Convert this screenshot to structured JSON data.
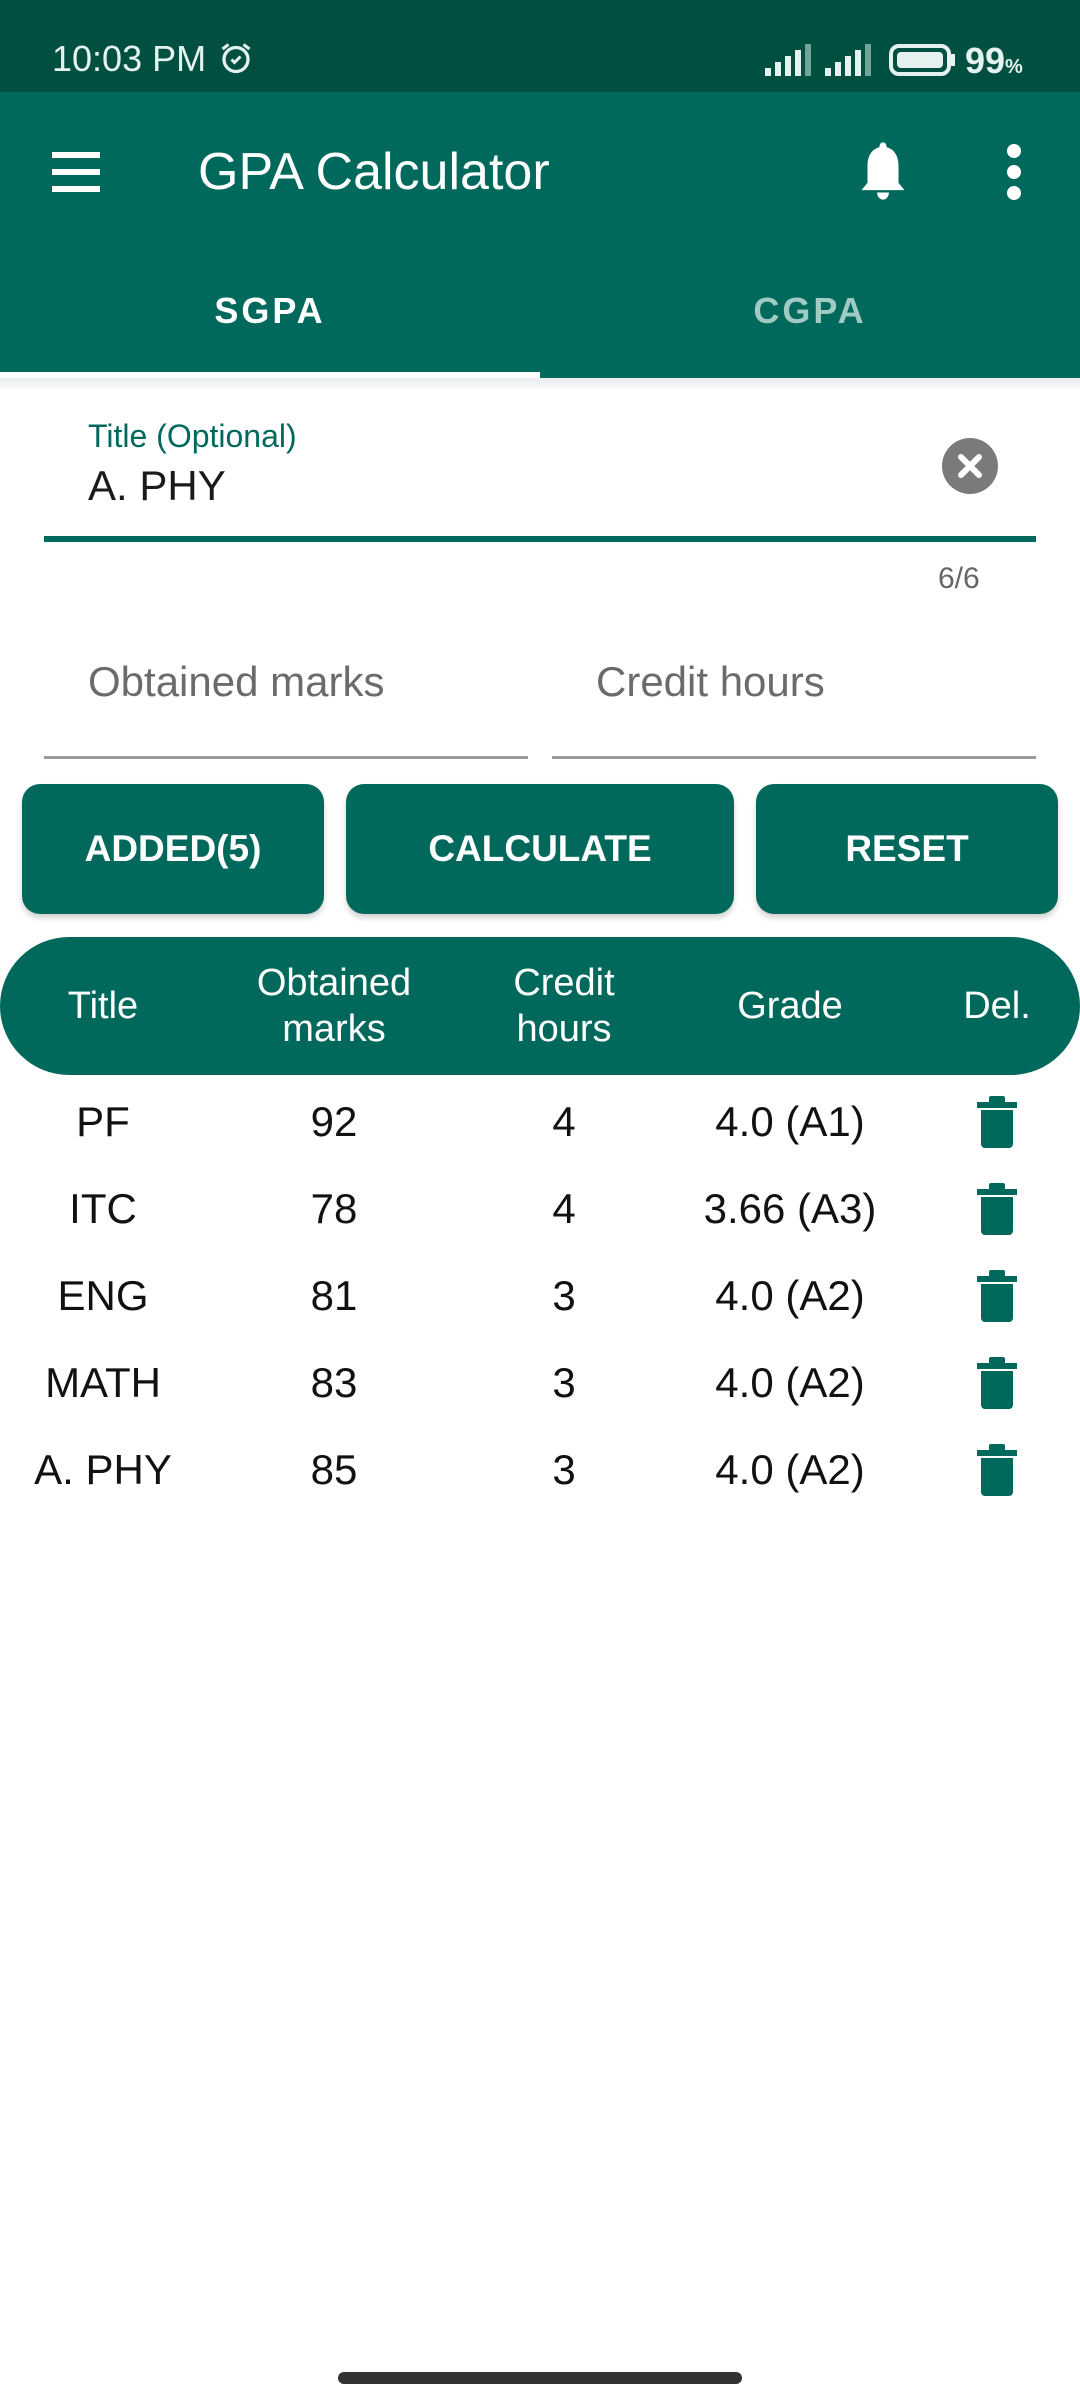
{
  "status_bar": {
    "time": "10:03 PM",
    "battery_percent": "99",
    "battery_unit": "%",
    "icons": [
      "alarm-icon",
      "signal-icon",
      "signal-icon",
      "battery-icon"
    ]
  },
  "app_bar": {
    "title": "GPA Calculator",
    "icons": [
      "menu-icon",
      "bell-icon",
      "more-vert-icon"
    ]
  },
  "tabs": [
    {
      "label": "SGPA",
      "active": true
    },
    {
      "label": "CGPA",
      "active": false
    }
  ],
  "form": {
    "title_field": {
      "label": "Title (Optional)",
      "value": "A. PHY",
      "counter": "6/6"
    },
    "marks_field": {
      "placeholder": "Obtained marks",
      "value": ""
    },
    "credit_field": {
      "placeholder": "Credit hours",
      "value": ""
    }
  },
  "buttons": {
    "added": "ADDED(5)",
    "calculate": "CALCULATE",
    "reset": "RESET"
  },
  "table": {
    "headers": {
      "title": "Title",
      "marks_line1": "Obtained",
      "marks_line2": "marks",
      "credit_line1": "Credit",
      "credit_line2": "hours",
      "grade": "Grade",
      "delete": "Del."
    },
    "rows": [
      {
        "title": "PF",
        "marks": "92",
        "credit": "4",
        "grade": "4.0 (A1)"
      },
      {
        "title": "ITC",
        "marks": "78",
        "credit": "4",
        "grade": "3.66 (A3)"
      },
      {
        "title": "ENG",
        "marks": "81",
        "credit": "3",
        "grade": "4.0 (A2)"
      },
      {
        "title": "MATH",
        "marks": "83",
        "credit": "3",
        "grade": "4.0 (A2)"
      },
      {
        "title": "A. PHY",
        "marks": "85",
        "credit": "3",
        "grade": "4.0 (A2)"
      }
    ]
  },
  "colors": {
    "primary": "#00695c",
    "status_bar": "#004f40",
    "inactive_tab": "#9fcbc3"
  }
}
